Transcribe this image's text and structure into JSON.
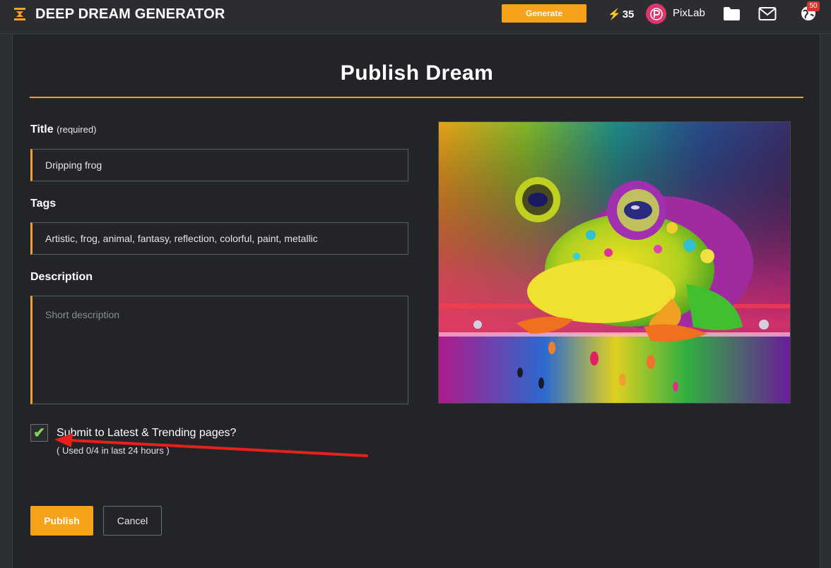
{
  "header": {
    "brand": "DEEP DREAM GENERATOR",
    "generate_label": "Generate",
    "energy_count": "35",
    "username": "PixLab",
    "notification_count": "50",
    "accent_color": "#f7a21b"
  },
  "page": {
    "title": "Publish Dream"
  },
  "form": {
    "title_label": "Title",
    "title_required": "(required)",
    "title_value": "Dripping frog",
    "tags_label": "Tags",
    "tags_value": "Artistic, frog, animal, fantasy, reflection, colorful, paint, metallic",
    "description_label": "Description",
    "description_placeholder": "Short description",
    "submit_label": "Submit to Latest & Trending pages?",
    "submit_usage": "( Used 0/4 in last 24 hours )",
    "submit_checked": true,
    "publish_label": "Publish",
    "cancel_label": "Cancel"
  },
  "preview": {
    "subject": "frog-illustration"
  }
}
